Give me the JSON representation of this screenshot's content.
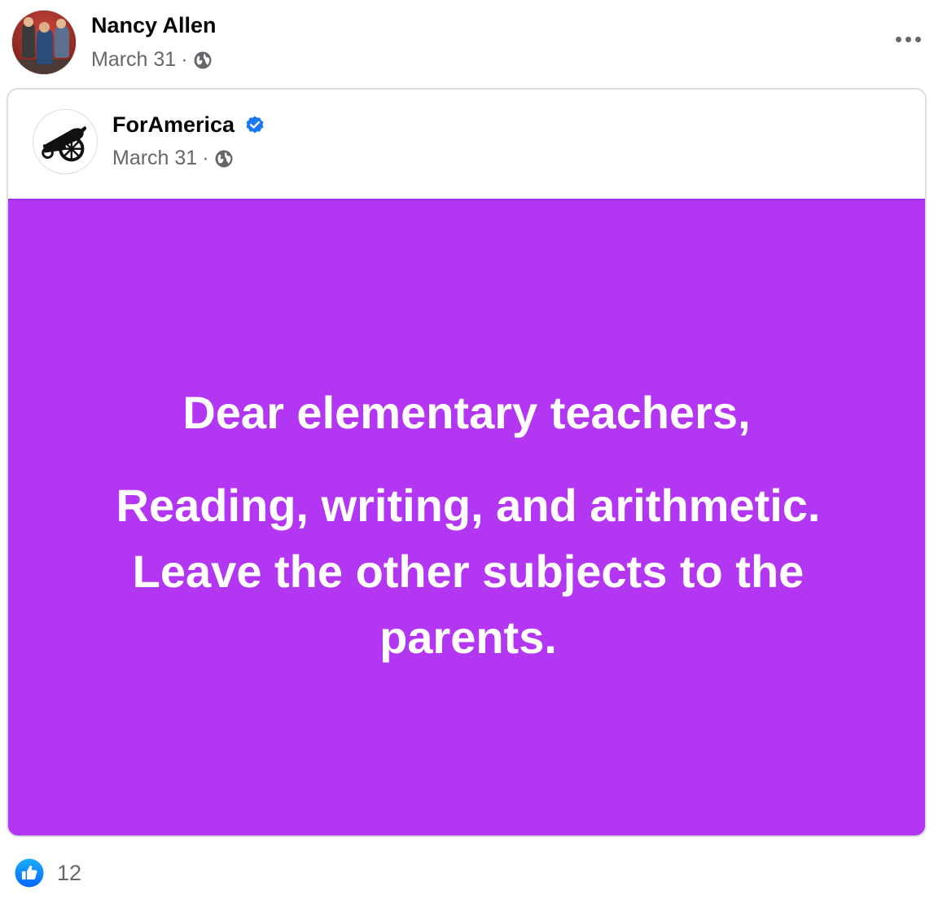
{
  "post": {
    "author": "Nancy Allen",
    "date": "March 31",
    "separator": "·",
    "privacy_icon": "globe-icon",
    "more_icon": "more-options-icon"
  },
  "shared": {
    "page_name": "ForAmerica",
    "verified_icon": "verified-badge-icon",
    "date": "March 31",
    "separator": "·",
    "privacy_icon": "globe-icon",
    "avatar_icon": "cannon-icon",
    "background_color": "#b336f2",
    "text_line1": "Dear elementary teachers,",
    "text_body": "Reading, writing, and arithmetic. Leave the other subjects to the parents."
  },
  "reactions": {
    "icon": "like-icon",
    "count": "12",
    "icon_color": "#1877f2"
  }
}
